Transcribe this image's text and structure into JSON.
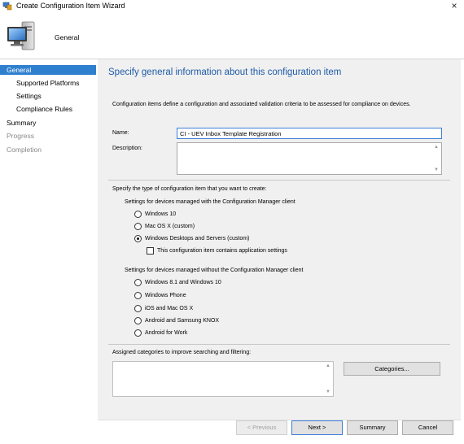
{
  "window": {
    "title": "Create Configuration Item Wizard",
    "close_glyph": "×"
  },
  "header": {
    "page_title": "General"
  },
  "sidebar": {
    "items": [
      {
        "label": "General"
      },
      {
        "label": "Supported Platforms"
      },
      {
        "label": "Settings"
      },
      {
        "label": "Compliance Rules"
      },
      {
        "label": "Summary"
      },
      {
        "label": "Progress"
      },
      {
        "label": "Completion"
      }
    ]
  },
  "main": {
    "heading": "Specify general information about this configuration item",
    "description": "Configuration items define a configuration and associated validation criteria to be assessed for compliance on devices.",
    "name_label": "Name:",
    "name_value": "CI - UEV Inbox Template Registration",
    "description_label": "Description:",
    "description_value": "",
    "type_prompt": "Specify the type of configuration item that you want to create:",
    "managed_group_label": "Settings for devices managed with the Configuration Manager client",
    "managed_options": [
      {
        "label": "Windows 10",
        "selected": false
      },
      {
        "label": "Mac OS X (custom)",
        "selected": false
      },
      {
        "label": "Windows Desktops and Servers (custom)",
        "selected": true
      }
    ],
    "app_settings_checkbox": {
      "label": "This configuration item contains application settings",
      "checked": false
    },
    "unmanaged_group_label": "Settings for devices managed without the Configuration Manager client",
    "unmanaged_options": [
      {
        "label": "Windows 8.1 and Windows 10",
        "selected": false
      },
      {
        "label": "Windows Phone",
        "selected": false
      },
      {
        "label": "iOS and Mac OS X",
        "selected": false
      },
      {
        "label": "Android and Samsung KNOX",
        "selected": false
      },
      {
        "label": "Android for Work",
        "selected": false
      }
    ],
    "categories_label": "Assigned categories to improve searching and filtering:",
    "categories_button": "Categories..."
  },
  "footer": {
    "previous": "< Previous",
    "next": "Next >",
    "summary": "Summary",
    "cancel": "Cancel"
  },
  "colors": {
    "accent": "#2f7fcf",
    "heading": "#1e5aa8",
    "panel": "#f0f0f0"
  }
}
